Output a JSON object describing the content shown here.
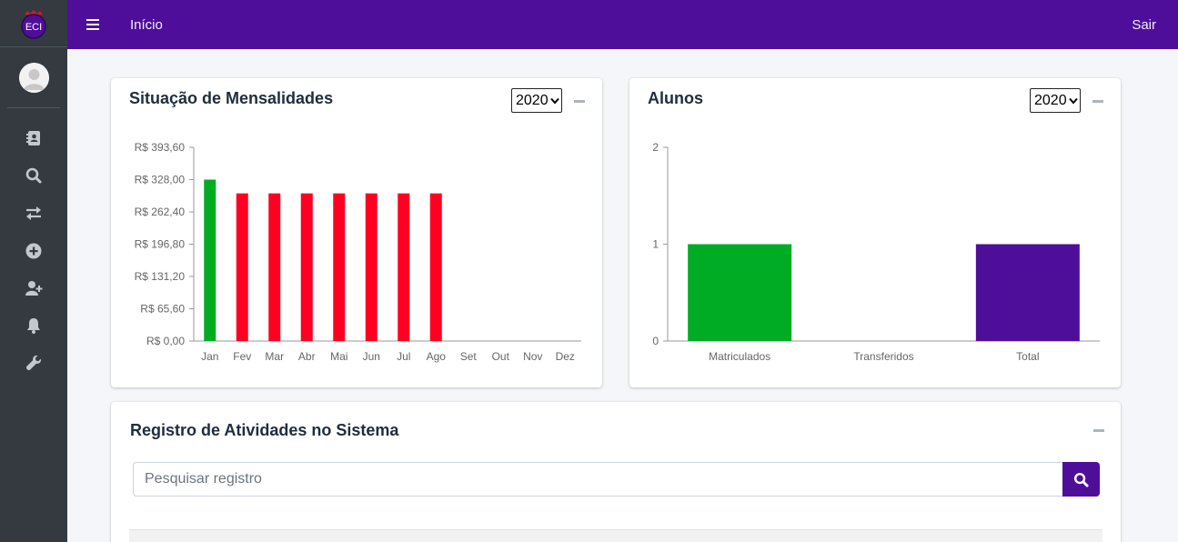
{
  "brand": {
    "logo_text": "ECI"
  },
  "sidebar": {
    "items": [
      {
        "icon": "address-book-icon",
        "name": "sidebar-item-cadastro"
      },
      {
        "icon": "search-icon",
        "name": "sidebar-item-pesquisa"
      },
      {
        "icon": "exchange-icon",
        "name": "sidebar-item-transferencia"
      },
      {
        "icon": "plus-circle-icon",
        "name": "sidebar-item-adicionar"
      },
      {
        "icon": "user-plus-icon",
        "name": "sidebar-item-novo-aluno"
      },
      {
        "icon": "bell-icon",
        "name": "sidebar-item-notificacoes"
      },
      {
        "icon": "wrench-icon",
        "name": "sidebar-item-configuracoes"
      }
    ]
  },
  "topbar": {
    "home_label": "Início",
    "logout_label": "Sair"
  },
  "colors": {
    "primary": "#4f0e9a",
    "sidebar": "#343a40",
    "paid": "#00ac24",
    "unpaid": "#ff0022",
    "total": "#4f0e9a"
  },
  "mensalidades": {
    "title": "Situação de Mensalidades",
    "year": "2020",
    "chart_data": {
      "type": "bar",
      "categories": [
        "Jan",
        "Fev",
        "Mar",
        "Abr",
        "Mai",
        "Jun",
        "Jul",
        "Ago",
        "Set",
        "Out",
        "Nov",
        "Dez"
      ],
      "values": [
        328,
        300,
        300,
        300,
        300,
        300,
        300,
        300,
        0,
        0,
        0,
        0
      ],
      "status": [
        "paid",
        "unpaid",
        "unpaid",
        "unpaid",
        "unpaid",
        "unpaid",
        "unpaid",
        "unpaid",
        "none",
        "none",
        "none",
        "none"
      ],
      "ylim": [
        0,
        393.6
      ],
      "yticks": [
        0,
        65.6,
        131.2,
        196.8,
        262.4,
        328,
        393.6
      ],
      "ytick_labels": [
        "R$ 0,00",
        "R$ 65,60",
        "R$ 131,20",
        "R$ 196,80",
        "R$ 262,40",
        "R$ 328,00",
        "R$ 393,60"
      ]
    }
  },
  "alunos": {
    "title": "Alunos",
    "year": "2020",
    "chart_data": {
      "type": "bar",
      "categories": [
        "Matriculados",
        "Transferidos",
        "Total"
      ],
      "values": [
        1,
        0,
        1
      ],
      "ylim": [
        0,
        2
      ],
      "yticks": [
        0,
        1,
        2
      ],
      "ytick_labels": [
        "0",
        "1",
        "2"
      ]
    }
  },
  "registro": {
    "title": "Registro de Atividades no Sistema",
    "search_placeholder": "Pesquisar registro"
  }
}
